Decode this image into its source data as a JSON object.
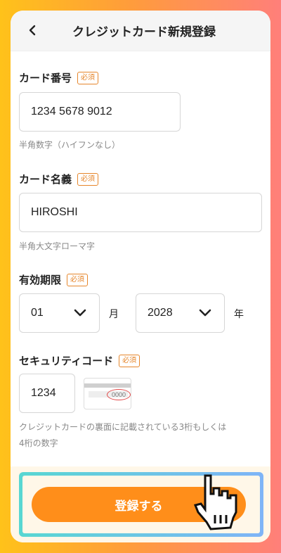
{
  "header": {
    "title": "クレジットカード新規登録"
  },
  "required_badge": "必須",
  "card_number": {
    "label": "カード番号",
    "value": "1234 5678 9012",
    "hint": "半角数字（ハイフンなし）"
  },
  "card_name": {
    "label": "カード名義",
    "value": "HIROSHI",
    "hint": "半角大文字ローマ字"
  },
  "expiry": {
    "label": "有効期限",
    "month": "01",
    "month_unit": "月",
    "year": "2028",
    "year_unit": "年"
  },
  "security": {
    "label": "セキュリティコード",
    "value": "1234",
    "card_example": "0000",
    "hint_line1": "クレジットカードの裏面に記載されている3桁もしくは",
    "hint_line2": "4桁の数字"
  },
  "submit": {
    "label": "登録する"
  },
  "colors": {
    "accent": "#ff8e1a",
    "required": "#e6862b"
  }
}
